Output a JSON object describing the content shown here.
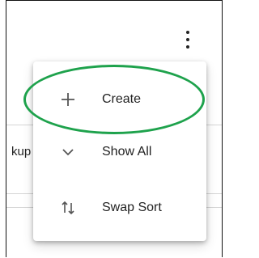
{
  "background": {
    "row_text": "kup"
  },
  "menu": {
    "items": [
      {
        "label": "Create",
        "icon": "plus-icon"
      },
      {
        "label": "Show All",
        "icon": "chevron-down-icon"
      },
      {
        "label": "Swap Sort",
        "icon": "swap-sort-icon"
      }
    ]
  },
  "colors": {
    "highlight": "#1ea24c",
    "text": "#222222"
  }
}
